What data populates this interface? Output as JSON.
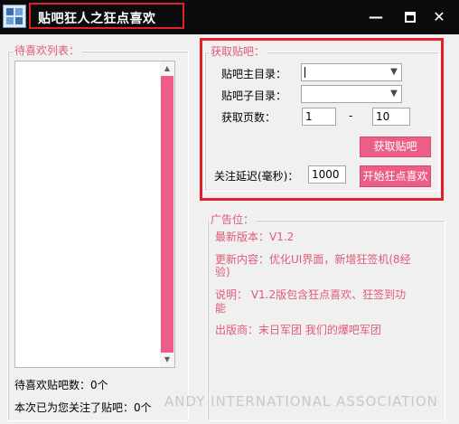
{
  "window": {
    "title": "贴吧狂人之狂点喜欢",
    "icon": "app-icon",
    "controls": {
      "minimize": "minimize-icon",
      "maximize": "maximize-icon",
      "close": "close-icon"
    }
  },
  "left_panel": {
    "title": "待喜欢列表：",
    "items": [],
    "count_text": "待喜欢贴吧数：0个",
    "followed_text": "本次已为您关注了贴吧：0个"
  },
  "fetch_panel": {
    "title": "获取贴吧：",
    "main_dir_label": "贴吧主目录：",
    "main_dir_value": "",
    "sub_dir_label": "贴吧子目录：",
    "sub_dir_value": "",
    "pages_label": "获取页数：",
    "page_from": "1",
    "page_sep": "-",
    "page_to": "10",
    "fetch_button": "获取贴吧",
    "delay_label": "关注延迟(毫秒)：",
    "delay_value": "1000",
    "start_button": "开始狂点喜欢"
  },
  "ad_panel": {
    "title": "广告位：",
    "lines": [
      "最新版本：V1.2",
      "更新内容：优化UI界面，新增狂签机(8经",
      "验)",
      "说明：  V1.2版包含狂点喜欢、狂签到功",
      "能",
      "出版商：末日军团 我们的爆吧军团"
    ]
  },
  "watermark": "ANDY INTERNATIONAL ASSOCIATION",
  "colors": {
    "accent": "#ec5e86",
    "label_pink": "#e05a78",
    "highlight_red": "#e0202a",
    "titlebar": "#0b0b0b"
  }
}
